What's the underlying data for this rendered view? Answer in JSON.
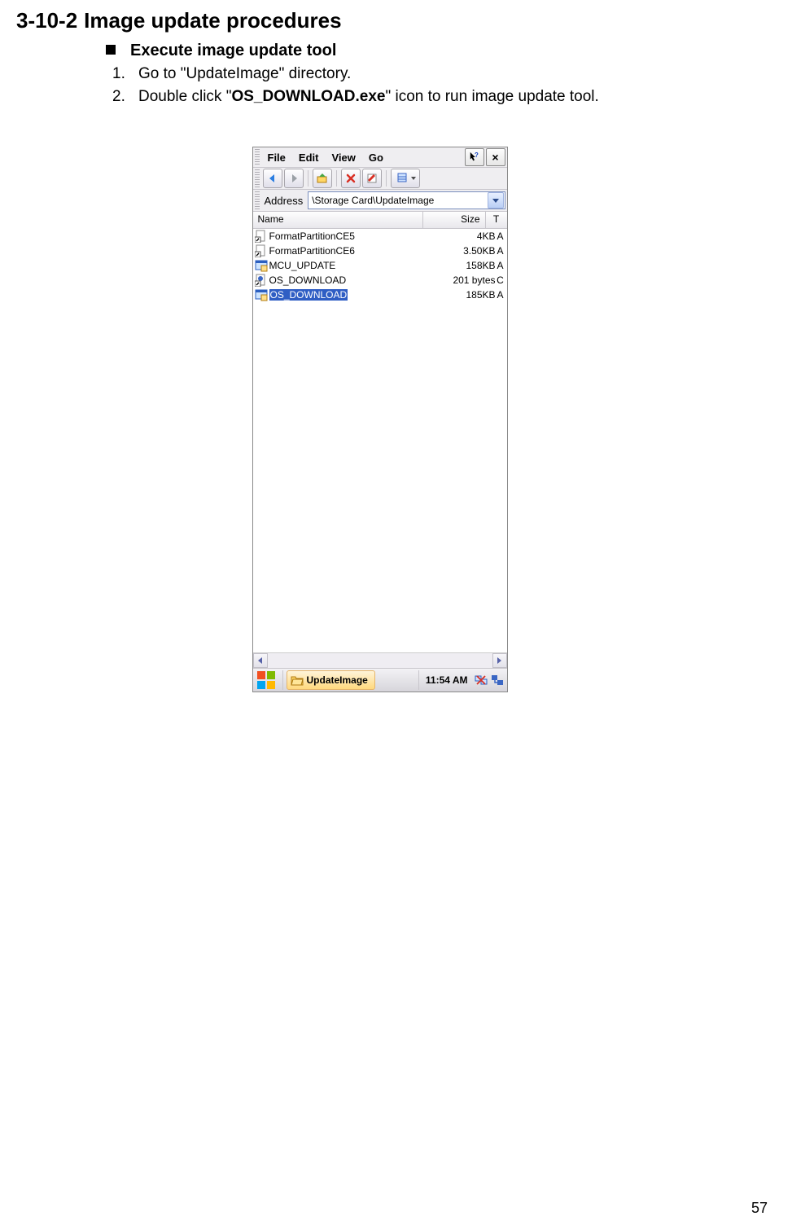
{
  "section": {
    "number": "3-10-2",
    "title": "Image update procedures"
  },
  "bullet": {
    "title": "Execute image update tool"
  },
  "steps": [
    {
      "n": "1.",
      "text_before": "Go to \"UpdateImage\" directory.",
      "bold": "",
      "text_after": ""
    },
    {
      "n": "2.",
      "text_before": "Double click \"",
      "bold": "OS_DOWNLOAD.exe",
      "text_after": "\" icon to run image update tool."
    }
  ],
  "menu": {
    "file": "File",
    "edit": "Edit",
    "view": "View",
    "go": "Go"
  },
  "close_x": "×",
  "address": {
    "label": "Address",
    "value": "\\Storage Card\\UpdateImage"
  },
  "columns": {
    "name": "Name",
    "size": "Size",
    "type": "T"
  },
  "files": [
    {
      "name": "FormatPartitionCE5",
      "size": "4KB",
      "t": "A",
      "icon": "shortcut",
      "selected": false
    },
    {
      "name": "FormatPartitionCE6",
      "size": "3.50KB",
      "t": "A",
      "icon": "shortcut",
      "selected": false
    },
    {
      "name": "MCU_UPDATE",
      "size": "158KB",
      "t": "A",
      "icon": "exe",
      "selected": false
    },
    {
      "name": "OS_DOWNLOAD",
      "size": "201 bytes",
      "t": "C",
      "icon": "shortcut",
      "selected": false
    },
    {
      "name": "OS_DOWNLOAD",
      "size": "185KB",
      "t": "A",
      "icon": "exe",
      "selected": true
    }
  ],
  "taskbar": {
    "app": "UpdateImage",
    "time": "11:54 AM"
  },
  "page_number": "57"
}
